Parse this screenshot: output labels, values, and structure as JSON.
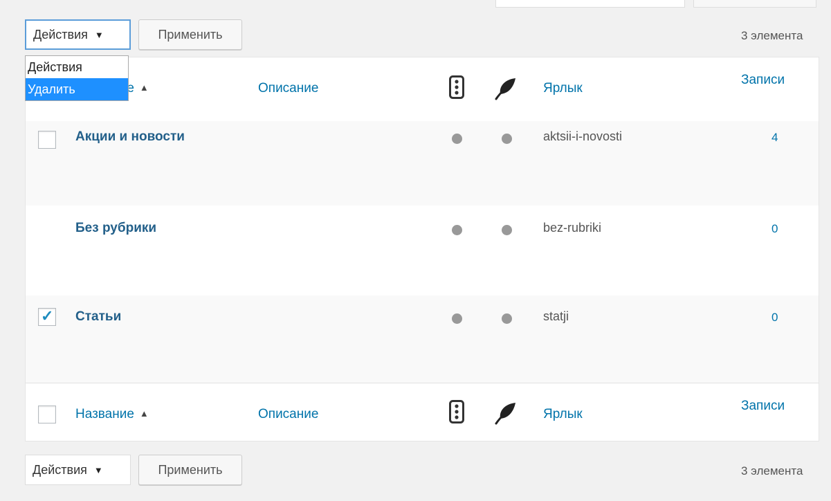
{
  "bulk_actions": {
    "selected": "Действия",
    "apply_label": "Применить",
    "options": [
      "Действия",
      "Удалить"
    ],
    "highlighted_option": "Удалить"
  },
  "item_count": "3 элемента",
  "columns": {
    "name": "Название",
    "description": "Описание",
    "slug": "Ярлык",
    "count": "Записи",
    "indicator_icon_1": "traffic-light-icon",
    "indicator_icon_2": "feather-icon"
  },
  "header_name_partial": "ие",
  "rows": [
    {
      "name": "Акции и новости",
      "slug": "aktsii-i-novosti",
      "count": "4",
      "checked": false,
      "has_checkbox": true
    },
    {
      "name": "Без рубрики",
      "slug": "bez-rubriki",
      "count": "0",
      "checked": false,
      "has_checkbox": false
    },
    {
      "name": "Статьи",
      "slug": "statji",
      "count": "0",
      "checked": true,
      "has_checkbox": true
    }
  ],
  "colors": {
    "link": "#0073aa",
    "highlight": "#1e90ff",
    "dot": "#999999"
  }
}
